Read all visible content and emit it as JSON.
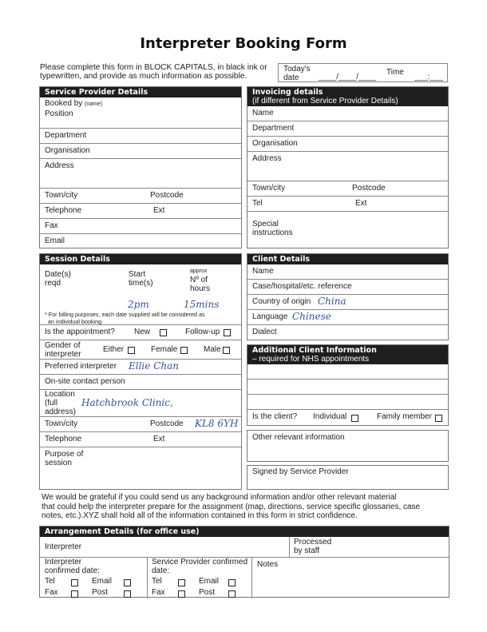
{
  "title": "Interpreter Booking Form",
  "intro": {
    "line1": "Please complete this form in BLOCK CAPITALS, in black ink or",
    "line2": "typewritten, and provide as much information as possible."
  },
  "date_box": {
    "todays_date_label_1": "Today's",
    "todays_date_label_2": "date",
    "date_blank": "____/____/____",
    "time_label": "Time",
    "time_blank": "___:___"
  },
  "service_provider": {
    "header": "Service Provider Details",
    "booked_by": "Booked by",
    "booked_by_note": "(name)",
    "position": "Position",
    "department": "Department",
    "organisation": "Organisation",
    "address": "Address",
    "town_city": "Town/city",
    "postcode": "Postcode",
    "telephone": "Telephone",
    "ext": "Ext",
    "fax": "Fax",
    "email": "Email"
  },
  "invoicing": {
    "header": "Invoicing details",
    "subheader": "(if different from Service Provider Details)",
    "name": "Name",
    "department": "Department",
    "organisation": "Organisation",
    "address": "Address",
    "town_city": "Town/city",
    "postcode": "Postcode",
    "tel": "Tel",
    "ext": "Ext",
    "special_1": "Special",
    "special_2": "instructions"
  },
  "session": {
    "header": "Session Details",
    "dates_1": "Date(s)",
    "dates_2": "reqd",
    "start_1": "Start",
    "start_2": "time(s)",
    "hours_0": "approx",
    "hours_1": "Nº of",
    "hours_2": "hours",
    "start_value": "2pm",
    "hours_value": "15mins",
    "note_1": "* For billing purposes, each date  supplied will be considered as",
    "note_2": "an individual booking",
    "appointment_label": "Is the appointment?",
    "new": "New",
    "follow_up": "Follow-up",
    "gender_1": "Gender of",
    "gender_2": "interpreter",
    "either": "Either",
    "female": "Female",
    "male": "Male",
    "preferred": "Preferred interpreter",
    "preferred_value": "Ellie Chan",
    "onsite": "On-site contact person",
    "location_1": "Location",
    "location_2": "(full",
    "location_3": "address)",
    "location_value": "Hatchbrook Clinic,",
    "town_city": "Town/city",
    "postcode": "Postcode",
    "postcode_value": "KL8 6YH",
    "telephone": "Telephone",
    "ext": "Ext",
    "purpose_1": "Purpose of",
    "purpose_2": "session"
  },
  "client": {
    "header": "Client Details",
    "name": "Name",
    "reference": "Case/hospital/etc. reference",
    "country": "Country of origin",
    "country_value": "China",
    "language": "Language",
    "language_value": "Chinese",
    "dialect": "Dialect"
  },
  "additional": {
    "header": "Additional Client Information",
    "subheader": "– required for NHS appointments",
    "is_client": "Is the client?",
    "individual": "Individual",
    "family": "Family member"
  },
  "other_info": "Other relevant information",
  "signed": "Signed by Service Provider",
  "paragraph": {
    "line1": "We would be grateful if you could send us any background information and/or other relevant material",
    "line2": "that could help the interpreter prepare for the assignment (map, directions, service specific glossaries, case",
    "line3": "notes,  etc.).XYZ shall hold all of the information contained in this form in strict confidence."
  },
  "arrangement": {
    "header": "Arrangement Details (for office use)",
    "interpreter": "Interpreter",
    "processed_1": "Processed",
    "processed_2": "by staff",
    "interp_confirmed_1": "Interpreter",
    "interp_confirmed_2": "confirmed date:",
    "sp_confirmed_1": "Service Provider confirmed",
    "sp_confirmed_2": "date:",
    "tel": "Tel",
    "email": "Email",
    "fax": "Fax",
    "post": "Post",
    "notes": "Notes"
  }
}
